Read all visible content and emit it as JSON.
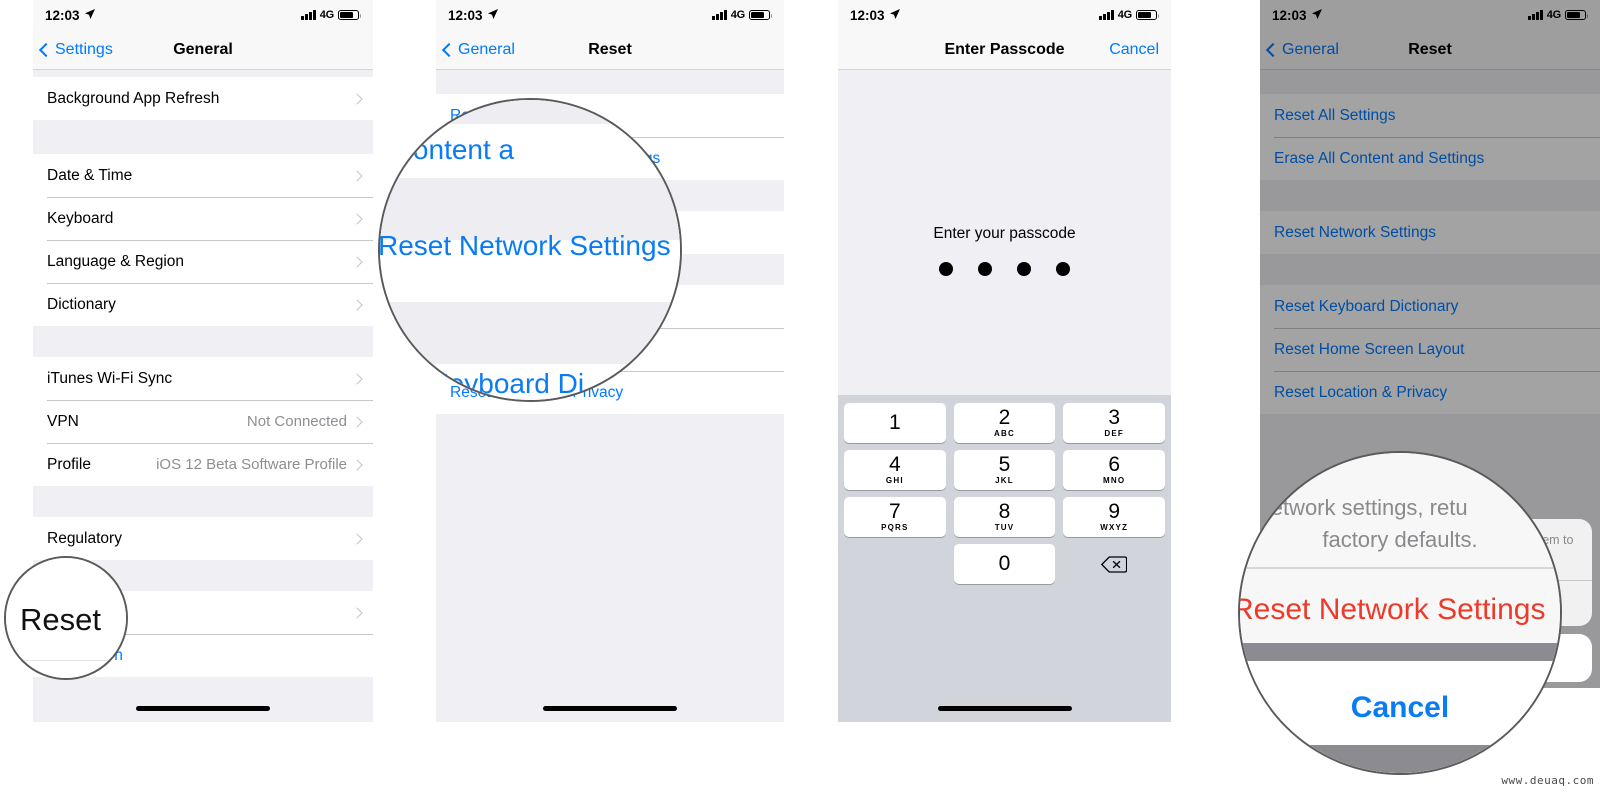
{
  "statusbar": {
    "time": "12:03",
    "network": "4G",
    "location_icon": "location-arrow-icon"
  },
  "watermark": "www.deuaq.com",
  "panel1": {
    "nav": {
      "back_label": "Settings",
      "title": "General"
    },
    "rows": [
      {
        "label": "Background App Refresh",
        "value": "",
        "chevron": true
      },
      {
        "label": "Date & Time",
        "value": "",
        "chevron": true
      },
      {
        "label": "Keyboard",
        "value": "",
        "chevron": true
      },
      {
        "label": "Language & Region",
        "value": "",
        "chevron": true
      },
      {
        "label": "Dictionary",
        "value": "",
        "chevron": true
      },
      {
        "label": "iTunes Wi-Fi Sync",
        "value": "",
        "chevron": true
      },
      {
        "label": "VPN",
        "value": "Not Connected",
        "chevron": true
      },
      {
        "label": "Profile",
        "value": "iOS 12 Beta Software Profile",
        "chevron": true
      },
      {
        "label": "Regulatory",
        "value": "",
        "chevron": true
      },
      {
        "label": "Reset",
        "value": "",
        "chevron": true
      },
      {
        "label": "Shut Down",
        "value": "",
        "chevron": false
      }
    ],
    "loupe": {
      "text": "Reset"
    }
  },
  "panel2": {
    "nav": {
      "back_label": "General",
      "title": "Reset"
    },
    "rows": [
      {
        "label": "Reset All Settings"
      },
      {
        "label": "Erase All Content and Settings"
      },
      {
        "label": "Reset Network Settings"
      },
      {
        "label": "Reset Keyboard Dictionary"
      },
      {
        "label": "Reset Home Screen Layout"
      },
      {
        "label": "Reset Location & Privacy"
      }
    ],
    "loupe": {
      "top_text": "e All Content a",
      "mid_text": "Reset Network Settings",
      "bottom_text": "Keyboard Di"
    }
  },
  "panel3": {
    "nav": {
      "title": "Enter Passcode",
      "cancel_label": "Cancel"
    },
    "prompt": "Enter your passcode",
    "dots_filled": 4,
    "keypad": [
      [
        {
          "num": "1",
          "letters": ""
        },
        {
          "num": "2",
          "letters": "ABC"
        },
        {
          "num": "3",
          "letters": "DEF"
        }
      ],
      [
        {
          "num": "4",
          "letters": "GHI"
        },
        {
          "num": "5",
          "letters": "JKL"
        },
        {
          "num": "6",
          "letters": "MNO"
        }
      ],
      [
        {
          "num": "7",
          "letters": "PQRS"
        },
        {
          "num": "8",
          "letters": "TUV"
        },
        {
          "num": "9",
          "letters": "WXYZ"
        }
      ],
      [
        {
          "num": "",
          "letters": ""
        },
        {
          "num": "0",
          "letters": ""
        },
        {
          "num": "delete-icon",
          "letters": ""
        }
      ]
    ]
  },
  "panel4": {
    "nav": {
      "back_label": "General",
      "title": "Reset"
    },
    "rows": [
      {
        "label": "Reset All Settings"
      },
      {
        "label": "Erase All Content and Settings"
      },
      {
        "label": "Reset Network Settings"
      },
      {
        "label": "Reset Keyboard Dictionary"
      },
      {
        "label": "Reset Home Screen Layout"
      },
      {
        "label": "Reset Location & Privacy"
      }
    ],
    "sheet": {
      "message": "This will reset all network settings, returning them to factory defaults.",
      "destructive_label": "Reset Network Settings",
      "cancel_label": "Cancel"
    },
    "loupe": {
      "msg_line1": "e all network settings, retu",
      "msg_line2": "factory defaults.",
      "action_text": "Reset Network Settings",
      "cancel_text": "Cancel"
    }
  },
  "colors": {
    "ios_blue": "#007aff",
    "ios_red": "#ff3b30",
    "group_bg": "#efeff4",
    "separator": "#c8c7cc",
    "secondary_text": "#8e8e93"
  }
}
